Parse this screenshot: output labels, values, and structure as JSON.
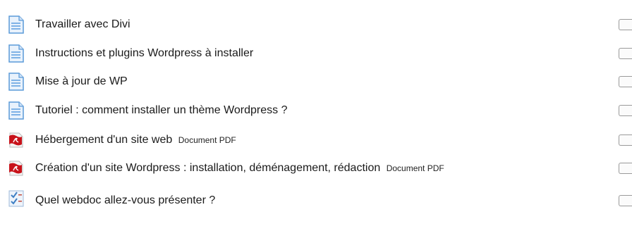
{
  "activities": [
    {
      "name": "Travailler avec Divi",
      "type": "",
      "icon": "page-icon"
    },
    {
      "name": "Instructions et plugins Wordpress à installer",
      "type": "",
      "icon": "page-icon"
    },
    {
      "name": "Mise à jour de WP",
      "type": "",
      "icon": "page-icon"
    },
    {
      "name": "Tutoriel : comment installer un thème Wordpress ?",
      "type": "",
      "icon": "page-icon"
    },
    {
      "name": "Hébergement d'un site web",
      "type": "Document PDF",
      "icon": "pdf-icon"
    },
    {
      "name": "Création d'un site Wordpress : installation, déménagement, rédaction",
      "type": "Document PDF",
      "icon": "pdf-icon"
    },
    {
      "name": "Quel webdoc allez-vous présenter ?",
      "type": "",
      "icon": "choice-icon"
    }
  ],
  "colors": {
    "pdf_red": "#c8121a",
    "page_blue": "#5a9ad8",
    "choice_blue": "#3e7fc4"
  }
}
